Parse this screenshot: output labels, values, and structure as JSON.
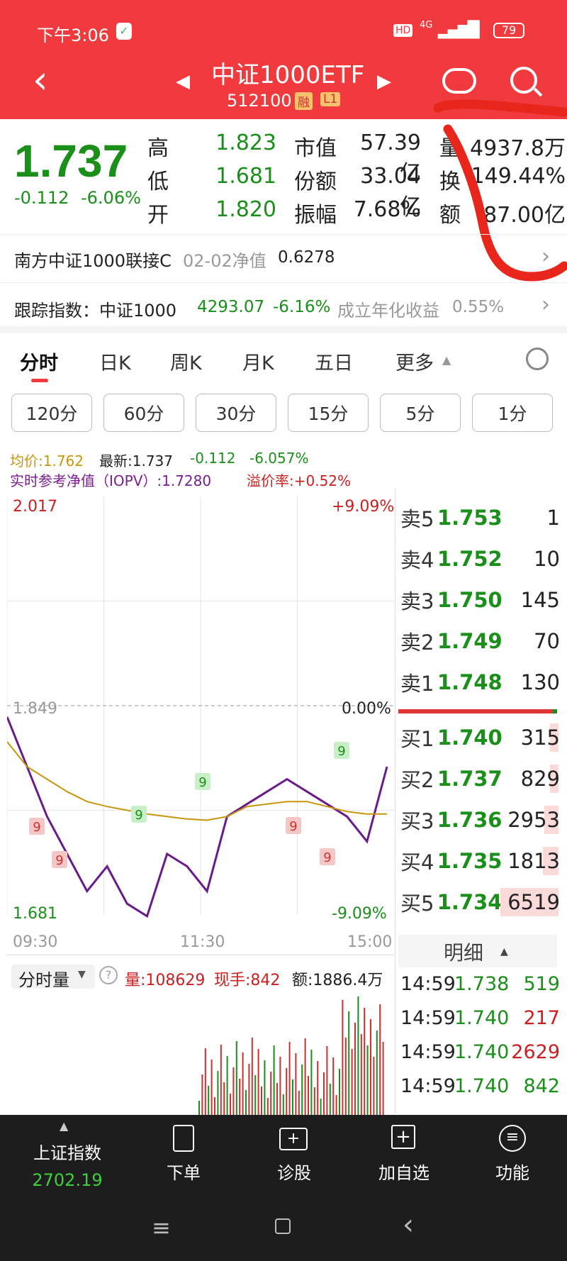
{
  "status": {
    "time": "下午3:06",
    "network": "4G",
    "battery": "79"
  },
  "header": {
    "title": "中证1000ETF",
    "code": "512100",
    "badge_margin": "融",
    "badge_level": "L1"
  },
  "quote": {
    "price": "1.737",
    "change": "-0.112",
    "change_pct": "-6.06%",
    "high_label": "高",
    "high": "1.823",
    "low_label": "低",
    "low": "1.681",
    "open_label": "开",
    "open": "1.820",
    "mcap_label": "市值",
    "mcap": "57.39亿",
    "shares_label": "份额",
    "shares": "33.04亿",
    "amp_label": "振幅",
    "amp": "7.68%",
    "vol_label": "量",
    "vol": "4937.8万",
    "turn_label": "换",
    "turn": "149.44%",
    "amt_label": "额",
    "amt": "87.00亿"
  },
  "fund": {
    "name": "南方中证1000联接C",
    "date_label": "02-02净值",
    "nav": "0.6278"
  },
  "index": {
    "label": "跟踪指数：中证1000",
    "value": "4293.07",
    "pct": "-6.16%",
    "annual_label": "成立年化收益",
    "annual": "0.55%"
  },
  "tabs": [
    "分时",
    "日K",
    "周K",
    "月K",
    "五日",
    "更多"
  ],
  "periods": [
    "120分",
    "60分",
    "30分",
    "15分",
    "5分",
    "1分"
  ],
  "info": {
    "avg": "均价:1.762",
    "latest_label": "最新:1.737",
    "chg": "-0.112",
    "pct": "-6.057%",
    "iopv": "实时参考净值（IOPV）:1.7280",
    "premium": "溢价率:+0.52%"
  },
  "chart": {
    "top": "2.017",
    "top_pct": "+9.09%",
    "mid": "1.849",
    "mid_pct": "0.00%",
    "bottom": "1.681",
    "bottom_pct": "-9.09%",
    "t_start": "09:30",
    "t_mid": "11:30",
    "t_end": "15:00",
    "marker": "9"
  },
  "chart_data": {
    "type": "line",
    "title": "",
    "x": [
      "09:30",
      "11:30",
      "15:00"
    ],
    "ylim": [
      1.681,
      2.017
    ],
    "series": [
      {
        "name": "最新",
        "values": [
          1.84,
          1.8,
          1.76,
          1.73,
          1.7,
          1.72,
          1.69,
          1.68,
          1.73,
          1.72,
          1.7,
          1.76,
          1.77,
          1.78,
          1.79,
          1.78,
          1.77,
          1.76,
          1.74,
          1.8
        ]
      },
      {
        "name": "均价",
        "values": [
          1.82,
          1.8,
          1.79,
          1.78,
          1.772,
          1.768,
          1.765,
          1.762,
          1.76,
          1.758,
          1.757,
          1.76,
          1.768,
          1.77,
          1.772,
          1.772,
          1.768,
          1.764,
          1.762,
          1.762
        ]
      }
    ]
  },
  "volume": {
    "label": "分时量",
    "vol": "量:108629",
    "hand": "现手:842",
    "amt": "额:1886.4万"
  },
  "orderbook": {
    "asks": [
      {
        "l": "卖5",
        "p": "1.753",
        "v": "1"
      },
      {
        "l": "卖4",
        "p": "1.752",
        "v": "10"
      },
      {
        "l": "卖3",
        "p": "1.750",
        "v": "145"
      },
      {
        "l": "卖2",
        "p": "1.749",
        "v": "70"
      },
      {
        "l": "卖1",
        "p": "1.748",
        "v": "130"
      }
    ],
    "bids": [
      {
        "l": "买1",
        "p": "1.740",
        "v": "315"
      },
      {
        "l": "买2",
        "p": "1.737",
        "v": "829"
      },
      {
        "l": "买3",
        "p": "1.736",
        "v": "2953"
      },
      {
        "l": "买4",
        "p": "1.735",
        "v": "1813"
      },
      {
        "l": "买5",
        "p": "1.734",
        "v": "6519"
      }
    ]
  },
  "ticks_title": "明细",
  "ticks": [
    {
      "t": "14:59",
      "p": "1.738",
      "v": "519"
    },
    {
      "t": "14:59",
      "p": "1.740",
      "v": "217"
    },
    {
      "t": "14:59",
      "p": "1.740",
      "v": "2629"
    },
    {
      "t": "14:59",
      "p": "1.740",
      "v": "842"
    }
  ],
  "bottom": {
    "index_name": "上证指数",
    "index_value": "2702.19",
    "order": "下单",
    "diag": "诊股",
    "fav": "加自选",
    "func": "功能"
  }
}
